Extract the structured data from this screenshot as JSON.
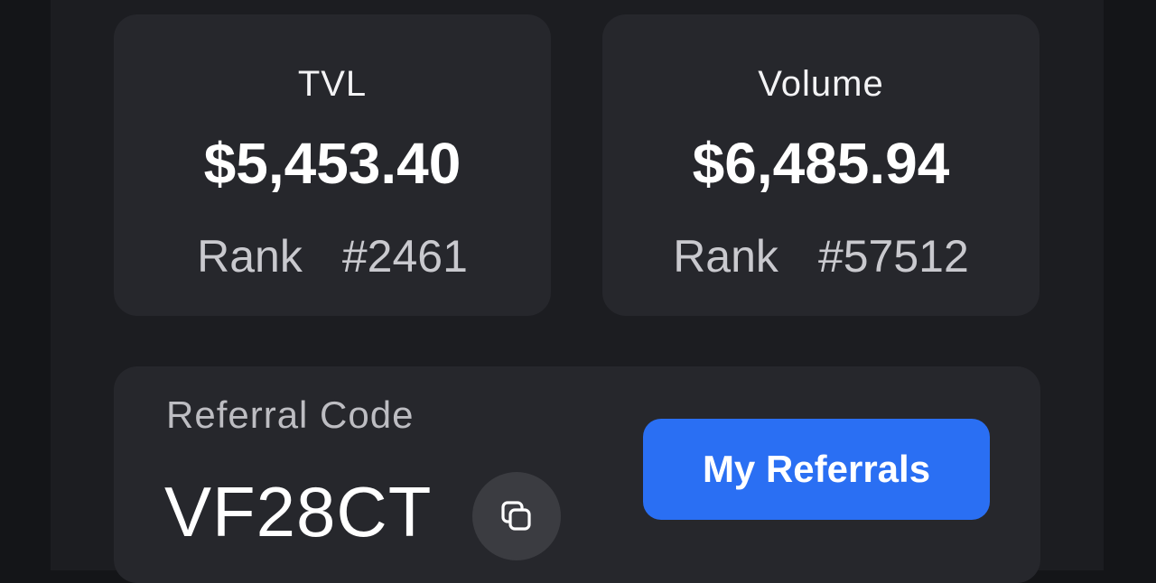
{
  "stats": {
    "tvl": {
      "label": "TVL",
      "value": "$5,453.40",
      "rank_label": "Rank",
      "rank_value": "#2461"
    },
    "volume": {
      "label": "Volume",
      "value": "$6,485.94",
      "rank_label": "Rank",
      "rank_value": "#57512"
    }
  },
  "referral": {
    "label": "Referral Code",
    "code": "VF28CT",
    "copy_icon": "copy-icon",
    "button_label": "My Referrals"
  },
  "colors": {
    "background": "#141518",
    "panel": "#1c1d21",
    "card": "#26272c",
    "accent": "#2a6ff3"
  }
}
